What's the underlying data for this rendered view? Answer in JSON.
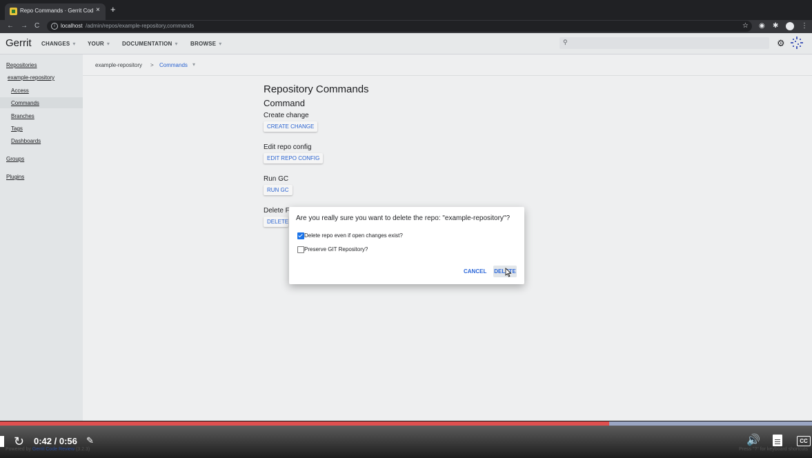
{
  "browser": {
    "tab_title": "Repo Commands · Gerrit Code",
    "tab_close": "×",
    "new_tab": "+",
    "back": "←",
    "forward": "→",
    "reload": "C",
    "url_host": "localhost",
    "url_path": "/admin/repos/example-repository,commands"
  },
  "header": {
    "logo": "Gerrit",
    "menus": [
      {
        "label": "CHANGES"
      },
      {
        "label": "YOUR"
      },
      {
        "label": "DOCUMENTATION"
      },
      {
        "label": "BROWSE"
      }
    ],
    "caret": "▾",
    "search_icon": "⚲"
  },
  "sidebar": {
    "repositories": "Repositories",
    "repo": "example-repository",
    "items": [
      {
        "label": "Access"
      },
      {
        "label": "Commands"
      },
      {
        "label": "Branches"
      },
      {
        "label": "Tags"
      },
      {
        "label": "Dashboards"
      }
    ],
    "groups": "Groups",
    "plugins": "Plugins"
  },
  "breadcrumb": {
    "repo": "example-repository",
    "separator": ">",
    "current": "Commands",
    "caret": "▾"
  },
  "main": {
    "title": "Repository Commands",
    "section": "Command",
    "commands": [
      {
        "label": "Create change",
        "button": "CREATE CHANGE"
      },
      {
        "label": "Edit repo config",
        "button": "EDIT REPO CONFIG"
      },
      {
        "label": "Run GC",
        "button": "RUN GC"
      },
      {
        "label": "Delete F",
        "button": "DELETE"
      }
    ]
  },
  "dialog": {
    "message": "Are you really sure you want to delete the repo: \"example-repository\"?",
    "option1": "Delete repo even if open changes exist?",
    "option2": "Preserve GIT Repository?",
    "cancel": "CANCEL",
    "delete": "DELETE"
  },
  "player": {
    "time": "0:42 / 0:56",
    "progress_fraction": 0.75,
    "cc": "CC",
    "powered_prefix": "Powered by",
    "powered_link": "Gerrit Code Review",
    "powered_version": "(3.2.3)",
    "keyboard_hint": "Press \"?\" for keyboard shortcuts"
  },
  "colors": {
    "accent": "#2a66d9",
    "progress": "#e05050"
  }
}
